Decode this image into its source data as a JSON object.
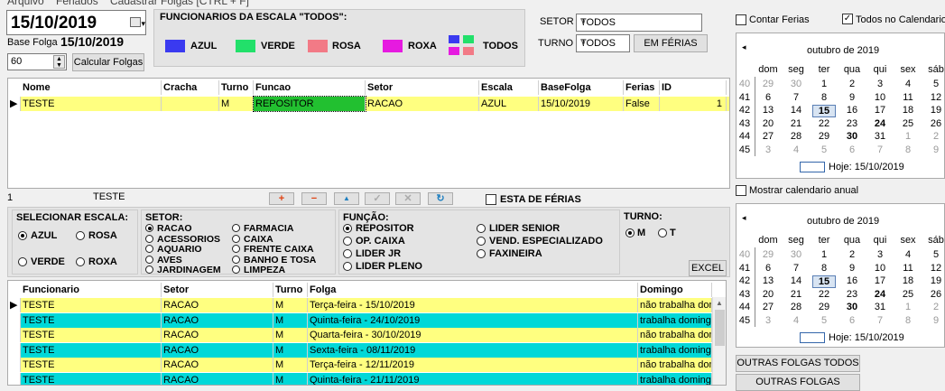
{
  "menu": [
    "Arquivo",
    "Feriados",
    "Cadastrar Folgas [CTRL + F]"
  ],
  "date_value": "15/10/2019",
  "base_folga_label": "Base Folga",
  "base_folga_value": "15/10/2019",
  "days_value": "60",
  "calc_button": "Calcular Folgas",
  "escala_title": "FUNCIONARIOS DA ESCALA  \"TODOS\":",
  "escalas": [
    {
      "label": "AZUL",
      "color": "#3a3af0"
    },
    {
      "label": "VERDE",
      "color": "#22e06a"
    },
    {
      "label": "ROSA",
      "color": "#f27a86"
    },
    {
      "label": "ROXA",
      "color": "#e61ae0"
    },
    {
      "label": "TODOS",
      "color": "multi"
    }
  ],
  "setor_label": "SETOR",
  "setor_value": "TODOS",
  "turno_label": "TURNO",
  "turno_value": "TODOS",
  "ferias_button": "EM FÉRIAS",
  "contar_ferias": "Contar Ferias",
  "todos_calendario": "Todos  no Calendario",
  "top_grid": {
    "headers": [
      "Nome",
      "Cracha",
      "Turno",
      "Funcao",
      "Setor",
      "Escala",
      "BaseFolga",
      "Ferias",
      "ID"
    ],
    "rows": [
      [
        "TESTE",
        "",
        "M",
        "REPOSITOR",
        "RACAO",
        "AZUL",
        "15/10/2019",
        "False",
        "1"
      ]
    ]
  },
  "record_count": "1",
  "record_name": "TESTE",
  "toolbar": [
    "+",
    "−",
    "▲",
    "✓",
    "✕",
    "↻"
  ],
  "esta_ferias": "ESTA DE FÉRIAS",
  "sel_escala_title": "SELECIONAR ESCALA:",
  "sel_escala_opts": [
    "AZUL",
    "ROSA",
    "VERDE",
    "ROXA"
  ],
  "setor_title": "SETOR:",
  "setor_opts": [
    "RACAO",
    "ACESSORIOS",
    "AQUARIO",
    "AVES",
    "JARDINAGEM",
    "FARMACIA",
    "CAIXA",
    "FRENTE CAIXA",
    "BANHO E TOSA",
    "LIMPEZA"
  ],
  "funcao_title": "FUNÇÃO:",
  "funcao_opts": [
    "REPOSITOR",
    "OP. CAIXA",
    "LIDER JR",
    "LIDER PLENO",
    "LIDER SENIOR",
    "VEND. ESPECIALIZADO",
    "FAXINEIRA"
  ],
  "turno_title": "TURNO:",
  "turno_opts": [
    "M",
    "T"
  ],
  "excel_button": "EXCEL",
  "bottom_grid": {
    "headers": [
      "Funcionario",
      "Setor",
      "Turno",
      "Folga",
      "Domingo"
    ],
    "rows": [
      [
        "TESTE",
        "RACAO",
        "M",
        "Terça-feira - 15/10/2019",
        "não trabalha domingo"
      ],
      [
        "TESTE",
        "RACAO",
        "M",
        "Quinta-feira - 24/10/2019",
        "trabalha domingo"
      ],
      [
        "TESTE",
        "RACAO",
        "M",
        "Quarta-feira - 30/10/2019",
        "não trabalha domingo"
      ],
      [
        "TESTE",
        "RACAO",
        "M",
        "Sexta-feira - 08/11/2019",
        "trabalha domingo"
      ],
      [
        "TESTE",
        "RACAO",
        "M",
        "Terça-feira - 12/11/2019",
        "não trabalha domingo"
      ],
      [
        "TESTE",
        "RACAO",
        "M",
        "Quinta-feira - 21/11/2019",
        "trabalha domingo"
      ]
    ],
    "row_colors": [
      "#ffff80",
      "#00d8d8",
      "#ffff80",
      "#00d8d8",
      "#ffff80",
      "#00d8d8"
    ]
  },
  "calendar1": {
    "month": "outubro de 2019",
    "days": [
      "dom",
      "seg",
      "ter",
      "qua",
      "qui",
      "sex",
      "sáb"
    ],
    "weeks": [
      [
        "40",
        "29",
        "30",
        "1",
        "2",
        "3",
        "4",
        "5"
      ],
      [
        "41",
        "6",
        "7",
        "8",
        "9",
        "10",
        "11",
        "12"
      ],
      [
        "42",
        "13",
        "14",
        "15",
        "16",
        "17",
        "18",
        "19"
      ],
      [
        "43",
        "20",
        "21",
        "22",
        "23",
        "24",
        "25",
        "26"
      ],
      [
        "44",
        "27",
        "28",
        "29",
        "30",
        "31",
        "1",
        "2"
      ],
      [
        "45",
        "3",
        "4",
        "5",
        "6",
        "7",
        "8",
        "9"
      ]
    ],
    "today": "Hoje: 15/10/2019"
  },
  "mostrar_anual": "Mostrar calendario anual",
  "calendar2": {
    "month": "outubro de 2019",
    "days": [
      "dom",
      "seg",
      "ter",
      "qua",
      "qui",
      "sex",
      "sáb"
    ],
    "weeks": [
      [
        "40",
        "29",
        "30",
        "1",
        "2",
        "3",
        "4",
        "5"
      ],
      [
        "41",
        "6",
        "7",
        "8",
        "9",
        "10",
        "11",
        "12"
      ],
      [
        "42",
        "13",
        "14",
        "15",
        "16",
        "17",
        "18",
        "19"
      ],
      [
        "43",
        "20",
        "21",
        "22",
        "23",
        "24",
        "25",
        "26"
      ],
      [
        "44",
        "27",
        "28",
        "29",
        "30",
        "31",
        "1",
        "2"
      ],
      [
        "45",
        "3",
        "4",
        "5",
        "6",
        "7",
        "8",
        "9"
      ]
    ],
    "today": "Hoje: 15/10/2019"
  },
  "outras_todos": "OUTRAS FOLGAS TODOS",
  "outras": "OUTRAS FOLGAS"
}
